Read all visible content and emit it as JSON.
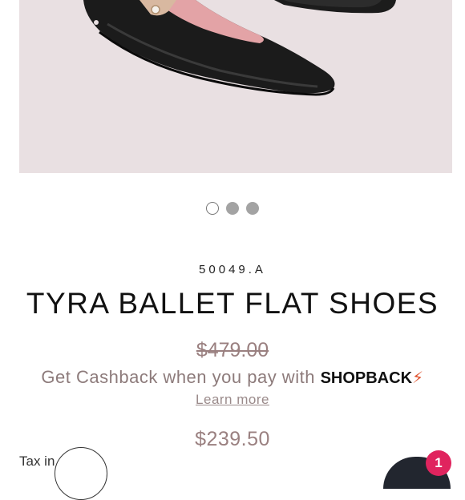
{
  "carousel": {
    "image_alt_name": "black-ballet-flat-shoe",
    "dot_count": 3,
    "active_index": 0
  },
  "product": {
    "sku": "50049.A",
    "title": "TYRA BALLET FLAT SHOES",
    "original_price": "$479.00",
    "sale_price": "$239.50"
  },
  "cashback": {
    "text": "Get Cashback when you pay with",
    "brand": "SHOPBACK",
    "brand_mark": "⚡",
    "learn_more": "Learn more"
  },
  "footer": {
    "tax_text": "Tax in",
    "chat_badge_count": "1"
  },
  "colors": {
    "hero_background": "#e9e0e2",
    "price_text": "#9a8080",
    "badge": "#e0245e",
    "chat_button": "#22262f"
  }
}
